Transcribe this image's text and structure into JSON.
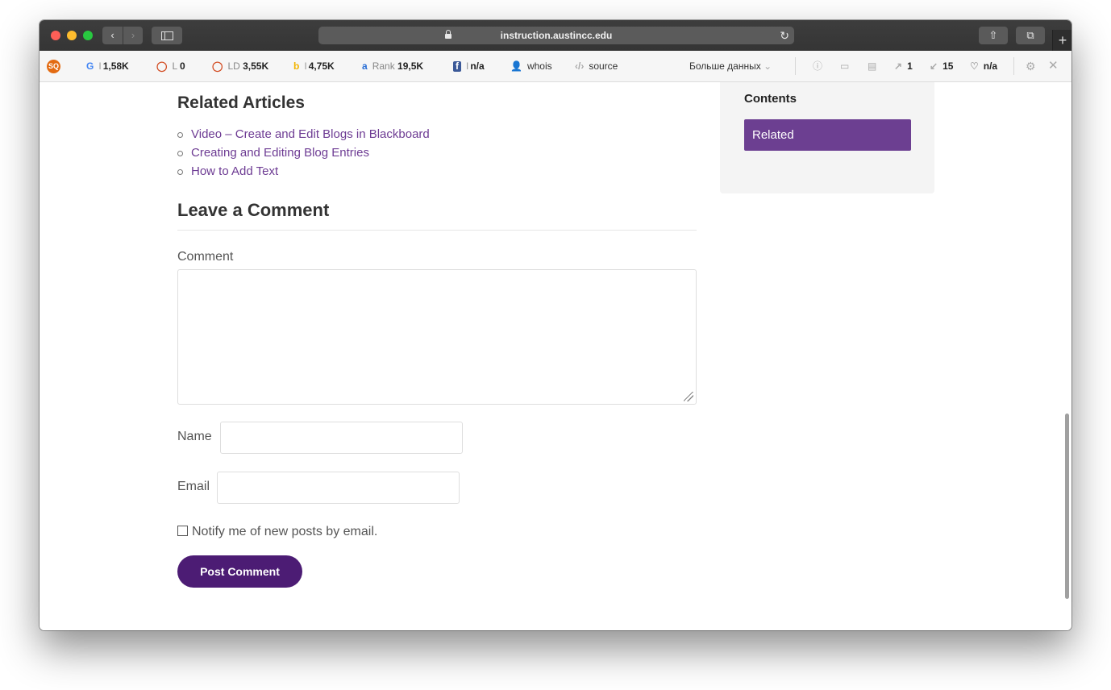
{
  "browser": {
    "url": "instruction.austincc.edu",
    "new_tab_label": "+",
    "nav_back_glyph": "‹",
    "nav_forward_glyph": "›",
    "reload_glyph": "↻",
    "share_glyph": "⇧",
    "tabs_glyph": "⧉"
  },
  "extension_bar": {
    "logo_text": "SQ",
    "google": {
      "icon": "G",
      "prefix": "I",
      "value": "1,58K"
    },
    "links": {
      "prefix": "L",
      "value": "0"
    },
    "link_domains": {
      "prefix": "LD",
      "value": "3,55K"
    },
    "bing": {
      "icon": "b",
      "prefix": "I",
      "value": "4,75K"
    },
    "rank": {
      "icon": "a",
      "label": "Rank",
      "value": "19,5K"
    },
    "facebook": {
      "icon": "f",
      "prefix": "I",
      "value": "n/a"
    },
    "whois_label": "whois",
    "source_label": "source",
    "more_data_label": "Больше данных",
    "external_links": {
      "icon": "↗",
      "value": "1"
    },
    "internal_links": {
      "icon": "↙",
      "value": "15"
    },
    "social": {
      "icon": "♡",
      "value": "n/a"
    },
    "settings_icon": "⚙",
    "close_icon": "✕"
  },
  "main": {
    "related_heading": "Related Articles",
    "related_links": [
      "Video – Create and Edit Blogs in Blackboard",
      "Creating and Editing Blog Entries",
      "How to Add Text"
    ],
    "comment_heading": "Leave a Comment",
    "comment_label": "Comment",
    "comment_value": "",
    "name_label": "Name",
    "name_value": "",
    "email_label": "Email",
    "email_value": "",
    "notify_label": "Notify me of new posts by email.",
    "notify_checked": false,
    "submit_label": "Post Comment"
  },
  "sidebar": {
    "heading": "Contents",
    "items": [
      "Related"
    ]
  },
  "colors": {
    "link": "#6d3b93",
    "submit_button": "#4c1c74",
    "active_toc": "#6c3f91"
  }
}
